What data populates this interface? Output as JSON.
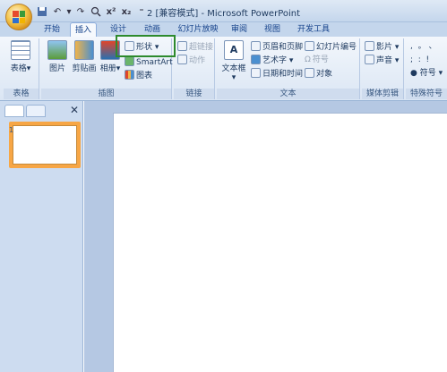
{
  "window": {
    "title": "2 [兼容模式] - Microsoft PowerPoint"
  },
  "quick_access": {
    "icons": [
      "save-icon",
      "undo-icon",
      "redo-icon",
      "print-preview-icon",
      "superscript-icon",
      "subscript-icon",
      "customize-icon"
    ],
    "superscript": "x²",
    "subscript": "x₂"
  },
  "tabs": [
    "开始",
    "插入",
    "设计",
    "动画",
    "幻灯片放映",
    "审阅",
    "视图",
    "开发工具"
  ],
  "active_tab": "插入",
  "ribbon": {
    "table_group": {
      "label": "表格",
      "table_button": "表格"
    },
    "illustrations_group": {
      "label": "插图",
      "picture": "图片",
      "clipart": "剪贴画",
      "album": "相册",
      "shapes": "形状",
      "smartart": "SmartArt",
      "chart": "图表"
    },
    "links_group": {
      "label": "链接",
      "hyperlink": "超链接",
      "action": "动作"
    },
    "text_group": {
      "label": "文本",
      "textbox": "文本框",
      "header_footer": "页眉和页脚",
      "wordart": "艺术字",
      "datetime": "日期和时间",
      "slide_number": "幻灯片编号",
      "symbol": "符号",
      "object": "对象"
    },
    "media_group": {
      "label": "媒体剪辑",
      "movie": "影片",
      "sound": "声音"
    },
    "special_group": {
      "label": "特殊符号",
      "symbol_btn": "符号"
    }
  },
  "slides_pane": {
    "thumb_number": "1"
  },
  "colors": {
    "accent": "#f7a645",
    "highlight_box": "#2d8a2d",
    "ribbon_bg": "#dbe6f4"
  }
}
